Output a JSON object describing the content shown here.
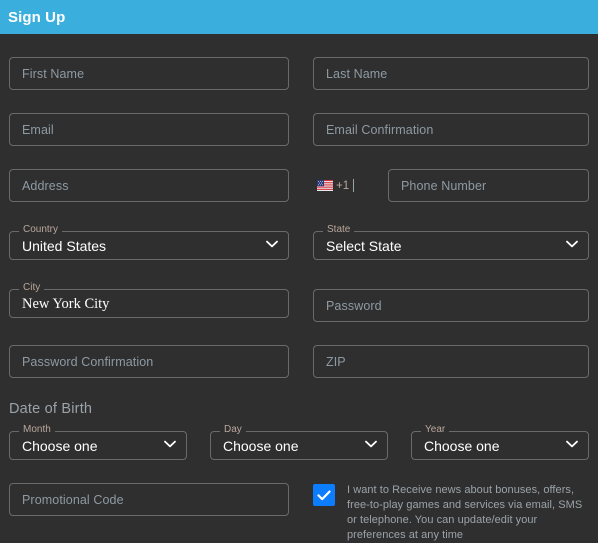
{
  "titlebar": {
    "title": "Sign Up"
  },
  "form": {
    "first_name": {
      "label": "First Name",
      "placeholder": "First Name",
      "value": ""
    },
    "last_name": {
      "label": "Last Name",
      "placeholder": "Last Name",
      "value": ""
    },
    "email": {
      "label": "Email",
      "placeholder": "Email",
      "value": ""
    },
    "email_confirmation": {
      "label": "Email Confirmation",
      "placeholder": "Email Confirmation",
      "value": ""
    },
    "address": {
      "label": "Address",
      "placeholder": "Address",
      "value": ""
    },
    "phone": {
      "dial_code": "+1",
      "flag": "us-flag-icon",
      "placeholder": "Phone Number",
      "value": ""
    },
    "country": {
      "label": "Country",
      "value": "United States",
      "icon": "chevron-down-icon"
    },
    "state": {
      "label": "State",
      "value": "Select State",
      "icon": "chevron-down-icon"
    },
    "city": {
      "label": "City",
      "value": "New York City"
    },
    "password": {
      "label": "Password",
      "placeholder": "Password",
      "value": ""
    },
    "password_confirmation": {
      "label": "Password Confirmation",
      "placeholder": "Password Confirmation",
      "value": ""
    },
    "zip": {
      "label": "ZIP",
      "placeholder": "ZIP",
      "value": ""
    },
    "date_of_birth": {
      "heading": "Date of Birth",
      "month": {
        "label": "Month",
        "value": "Choose one",
        "icon": "chevron-down-icon"
      },
      "day": {
        "label": "Day",
        "value": "Choose one",
        "icon": "chevron-down-icon"
      },
      "year": {
        "label": "Year",
        "value": "Choose one",
        "icon": "chevron-down-icon"
      }
    },
    "promotional_code": {
      "label": "Promotional Code",
      "placeholder": "Promotional Code",
      "value": ""
    },
    "consent": {
      "checked": true,
      "icon": "checkmark-icon",
      "text": "I want to Receive news about bonuses, offers, free-to-play games and services via email, SMS or telephone. You can update/edit your preferences at any time"
    }
  },
  "colors": {
    "header_bar": "#3aafdd",
    "page_background": "#2f2f2f",
    "field_border": "#6a6a6a",
    "placeholder_text": "#8e9aa3",
    "float_label": "#b9a79c",
    "value_text": "#ffffff",
    "checkbox_accent": "#0d7dff",
    "muted_text": "#9aa3a9"
  }
}
